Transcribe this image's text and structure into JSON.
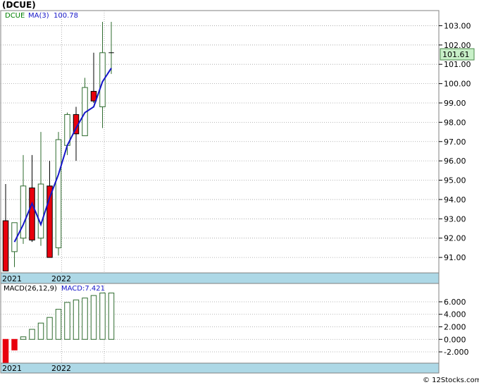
{
  "title": "(DCUE)",
  "footer": "© 12Stocks.com",
  "colors": {
    "up_outline": "#2e6b2e",
    "down_fill": "#e8000d",
    "ma_line": "#1515c8",
    "date_band": "#add8e6",
    "last_price_box": "#c8f0c8",
    "grid": "#a0a0a0"
  },
  "chart_data": [
    {
      "type": "candlestick",
      "legend": [
        {
          "label": "DCUE",
          "color": "#008000"
        },
        {
          "label": "MA(3)",
          "color": "#1515c8"
        },
        {
          "label": "100.78",
          "color": "#1515c8"
        }
      ],
      "last_price_label": "101.61",
      "ylim": [
        90.2,
        103.6
      ],
      "yticks": [
        "103.00",
        "102.00",
        "101.00",
        "100.00",
        "99.00",
        "98.00",
        "97.00",
        "96.00",
        "95.00",
        "94.00",
        "93.00",
        "92.00",
        "91.00"
      ],
      "year_labels": [
        {
          "label": "2021",
          "index": 0
        },
        {
          "label": "2022",
          "index": 7
        }
      ],
      "candles": [
        {
          "o": 92.9,
          "h": 94.8,
          "l": 90.3,
          "c": 90.3
        },
        {
          "o": 91.3,
          "h": 92.7,
          "l": 90.5,
          "c": 92.8
        },
        {
          "o": 92.0,
          "h": 96.3,
          "l": 91.7,
          "c": 94.7
        },
        {
          "o": 94.6,
          "h": 96.3,
          "l": 91.8,
          "c": 91.9
        },
        {
          "o": 92.0,
          "h": 97.5,
          "l": 91.6,
          "c": 94.8
        },
        {
          "o": 94.7,
          "h": 96.0,
          "l": 91.0,
          "c": 91.0
        },
        {
          "o": 91.5,
          "h": 97.5,
          "l": 91.1,
          "c": 97.1
        },
        {
          "o": 96.8,
          "h": 98.5,
          "l": 96.3,
          "c": 98.4
        },
        {
          "o": 98.4,
          "h": 98.8,
          "l": 96.0,
          "c": 97.4
        },
        {
          "o": 97.3,
          "h": 100.3,
          "l": 97.3,
          "c": 99.8
        },
        {
          "o": 99.6,
          "h": 101.6,
          "l": 99.0,
          "c": 99.1
        },
        {
          "o": 98.8,
          "h": 103.2,
          "l": 97.7,
          "c": 101.6
        },
        {
          "o": 101.6,
          "h": 103.2,
          "l": 100.5,
          "c": 101.6
        }
      ],
      "ma": [
        91.8,
        92.7,
        93.8,
        92.7,
        94.1,
        95.3,
        96.8,
        97.7,
        98.5,
        98.8,
        100.1,
        100.8
      ]
    },
    {
      "type": "bar",
      "legend": [
        {
          "label": "MACD(26,12,9)",
          "color": "#000000"
        },
        {
          "label": "MACD:7.421",
          "color": "#1515c8"
        }
      ],
      "ylim": [
        -3.8,
        7.8
      ],
      "yticks": [
        "6.000",
        "4.000",
        "2.000",
        "0.000",
        "-2.000"
      ],
      "year_labels": [
        {
          "label": "2021",
          "index": 0
        },
        {
          "label": "2022",
          "index": 7
        }
      ],
      "values": [
        -3.8,
        -1.7,
        0.4,
        1.6,
        2.6,
        3.5,
        4.8,
        5.9,
        6.3,
        6.6,
        7.0,
        7.4,
        7.4
      ]
    }
  ]
}
